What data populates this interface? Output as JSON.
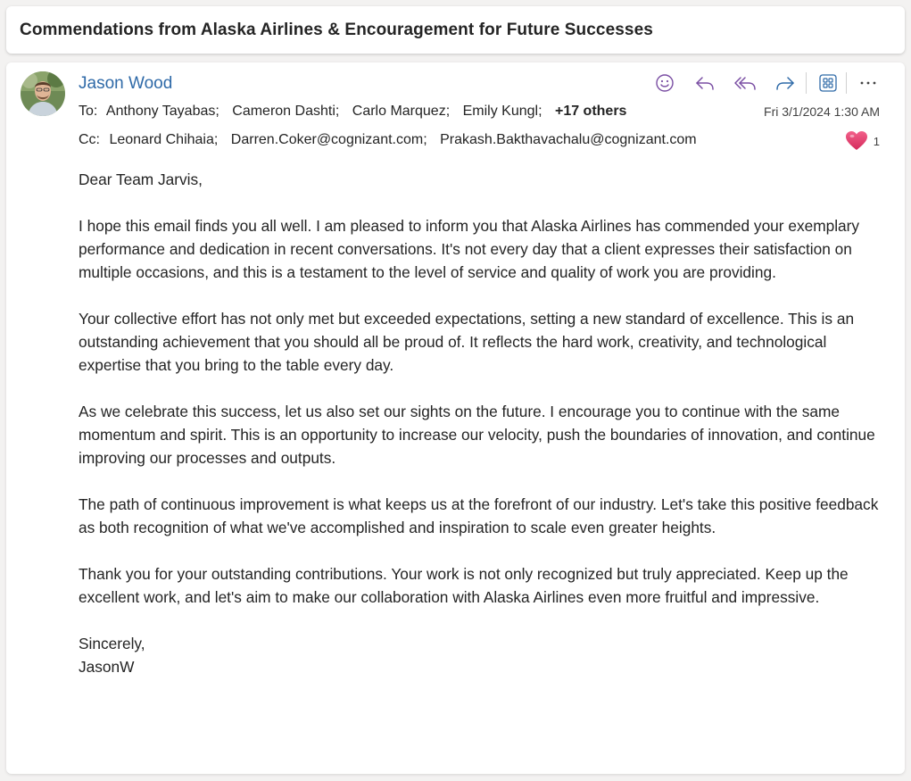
{
  "subject": "Commendations from Alaska Airlines & Encouragement for Future Successes",
  "message": {
    "sender_name": "Jason Wood",
    "to_label": "To:",
    "to": [
      "Anthony Tayabas;",
      "Cameron Dashti;",
      "Carlo Marquez;",
      "Emily Kungl;"
    ],
    "to_more": "+17 others",
    "cc_label": "Cc:",
    "cc": [
      "Leonard Chihaia;",
      "Darren.Coker@cognizant.com;",
      "Prakash.Bakthavachalu@cognizant.com"
    ],
    "date": "Fri 3/1/2024 1:30 AM",
    "reaction": {
      "icon": "heart-icon",
      "count": "1",
      "color": "#e8386b"
    },
    "toolbar": {
      "icons": [
        "emoji-icon",
        "reply-icon",
        "reply-all-icon",
        "forward-icon",
        "apps-icon",
        "more-icon"
      ],
      "accent": "#7a4ea3"
    },
    "body": {
      "greeting": "Dear Team Jarvis,",
      "p1": "I hope this email finds you all well. I am pleased to inform you that Alaska Airlines has commended your exemplary performance and dedication in recent conversations. It's not every day that a client expresses their satisfaction on multiple occasions, and this is a testament to the level of service and quality of work you are providing.",
      "p2": "Your collective effort has not only met but exceeded expectations, setting a new standard of excellence. This is an outstanding achievement that you should all be proud of. It reflects the hard work, creativity, and technological expertise that you bring to the table every day.",
      "p3": "As we celebrate this success, let us also set our sights on the future. I encourage you to continue with the same momentum and spirit. This is an opportunity to increase our velocity, push the boundaries of innovation, and continue improving our processes and outputs.",
      "p4": "The path of continuous improvement is what keeps us at the forefront of our industry. Let's take this positive feedback as both recognition of what we've accomplished and inspiration to scale even greater heights.",
      "p5": "Thank you for your outstanding contributions. Your work is not only recognized but truly appreciated. Keep up the excellent work, and let's aim to make our collaboration with Alaska Airlines even more fruitful and impressive.",
      "closing": "Sincerely,",
      "signature": "JasonW"
    }
  }
}
